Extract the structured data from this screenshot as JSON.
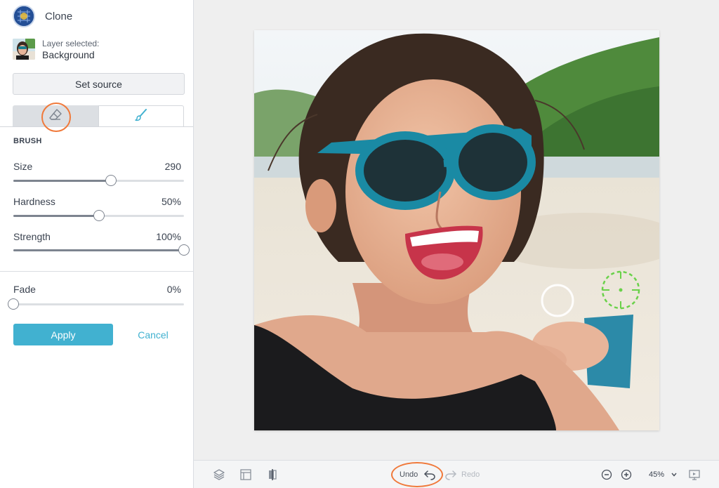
{
  "tool": {
    "title": "Clone",
    "icon": "clone-stamp-icon"
  },
  "layer": {
    "label": "Layer selected:",
    "name": "Background"
  },
  "set_source_label": "Set source",
  "tabs": [
    {
      "name": "erase",
      "icon": "eraser-icon",
      "active": false
    },
    {
      "name": "brush",
      "icon": "brush-icon",
      "active": true
    }
  ],
  "brush": {
    "section_title": "BRUSH",
    "size": {
      "label": "Size",
      "value": "290",
      "fraction": 0.57
    },
    "hardness": {
      "label": "Hardness",
      "value": "50%",
      "fraction": 0.5
    },
    "strength": {
      "label": "Strength",
      "value": "100%",
      "fraction": 1.0
    }
  },
  "fade": {
    "label": "Fade",
    "value": "0%",
    "fraction": 0.0
  },
  "actions": {
    "apply": "Apply",
    "cancel": "Cancel"
  },
  "bottombar": {
    "undo": "Undo",
    "redo": "Redo",
    "zoom": "45%",
    "icons": [
      "layers-icon",
      "crop-icon",
      "compare-icon",
      "undo-icon",
      "redo-icon",
      "zoom-out-icon",
      "zoom-in-icon",
      "chevron-down-icon",
      "present-icon"
    ]
  },
  "colors": {
    "accent": "#41b1d0",
    "highlight": "#f0793a",
    "clone_target": "#6ad14a"
  }
}
